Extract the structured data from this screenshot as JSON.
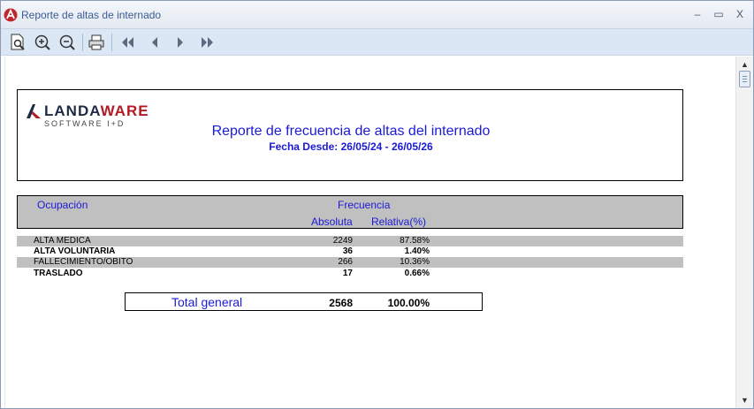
{
  "window": {
    "title": "Reporte de altas de internado",
    "minimize_glyph": "–",
    "maximize_glyph": "▭",
    "close_glyph": "X"
  },
  "toolbar": {
    "buttons": [
      {
        "name": "preview-page-icon"
      },
      {
        "name": "zoom-in-icon"
      },
      {
        "name": "zoom-out-icon"
      },
      {
        "name": "print-icon"
      },
      {
        "name": "first-page-icon"
      },
      {
        "name": "previous-page-icon"
      },
      {
        "name": "next-page-icon"
      },
      {
        "name": "last-page-icon"
      }
    ]
  },
  "report": {
    "logo_main_a": "LANDA",
    "logo_main_b": "WARE",
    "logo_sub": "SOFTWARE I+D",
    "title": "Reporte de frecuencia de altas del internado",
    "subtitle": "Fecha Desde: 26/05/24 - 26/05/26",
    "headers": {
      "ocupacion": "Ocupación",
      "frecuencia": "Frecuencia",
      "absoluta": "Absoluta",
      "relativa": "Relativa(%)"
    },
    "rows": [
      {
        "name": "ALTA MEDICA",
        "absoluta": "2249",
        "relativa": "87.58%"
      },
      {
        "name": "ALTA VOLUNTARIA",
        "absoluta": "36",
        "relativa": "1.40%"
      },
      {
        "name": "FALLECIMIENTO/OBITO",
        "absoluta": "266",
        "relativa": "10.36%"
      },
      {
        "name": "TRASLADO",
        "absoluta": "17",
        "relativa": "0.66%"
      }
    ],
    "total": {
      "label": "Total general",
      "absoluta": "2568",
      "relativa": "100.00%"
    }
  },
  "colors": {
    "accent_blue": "#1a1ad6",
    "band_gray": "#c0c0c0",
    "brand_red": "#b31b24"
  }
}
